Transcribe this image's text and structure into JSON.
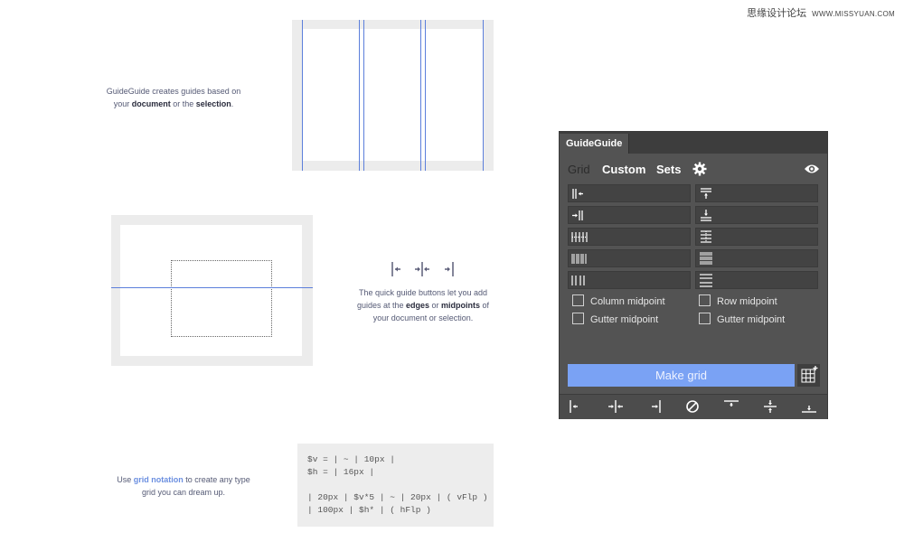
{
  "watermark": {
    "text": "思缘设计论坛",
    "site": "WWW.MISSYUAN.COM"
  },
  "captions": {
    "first": {
      "line1": "GuideGuide creates guides based on",
      "pre": "your ",
      "b1": "document",
      "mid": " or the ",
      "b2": "selection",
      "end": "."
    },
    "second": {
      "line1": "The quick guide buttons let you add",
      "pre": "guides at the ",
      "b1": "edges",
      "mid": " or ",
      "b2": "midpoints",
      "end": " of",
      "line3": "your document or selection."
    },
    "third": {
      "pre": "Use ",
      "link": "grid notation",
      "post": " to create any type",
      "line2": "grid you can dream up."
    }
  },
  "code_lines": [
    "$v = | ~ | 10px |",
    "$h = | 16px |",
    "",
    "| 20px | $v*5 | ~ | 20px | ( vFlp )",
    "| 100px | $h* | ( hFlp )"
  ],
  "panel": {
    "tab_title": "GuideGuide",
    "nav": {
      "grid": "Grid",
      "custom": "Custom",
      "sets": "Sets"
    },
    "icons": {
      "settings": "gear-icon",
      "visibility": "eye-icon"
    },
    "checkboxes": {
      "column_midpoint": "Column midpoint",
      "row_midpoint": "Row midpoint",
      "gutter_midpoint_left": "Gutter midpoint",
      "gutter_midpoint_right": "Gutter midpoint"
    },
    "make_grid_label": "Make grid",
    "colors": {
      "accent": "#7aa2f4",
      "panel_bg": "#535353",
      "guide_line": "#5c7fdb"
    }
  }
}
